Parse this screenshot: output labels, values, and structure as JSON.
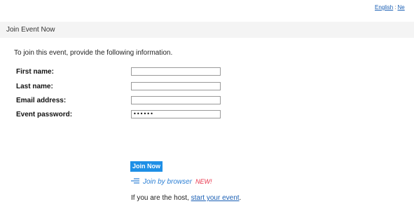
{
  "language_bar": {
    "current_language": "English",
    "separator": ":",
    "other_link": "Ne"
  },
  "header": {
    "title": "Join Event Now"
  },
  "form": {
    "instruction": "To join this event, provide the following information.",
    "fields": [
      {
        "label": "First name:",
        "value": ""
      },
      {
        "label": "Last name:",
        "value": ""
      },
      {
        "label": "Email address:",
        "value": ""
      },
      {
        "label": "Event password:",
        "value": "••••••"
      }
    ]
  },
  "actions": {
    "join_now": "Join Now",
    "join_by_browser": "Join by browser",
    "new_badge": "NEW!",
    "browser_icon": "lines-arrow-icon"
  },
  "host": {
    "text_prefix": "If you are the host, ",
    "link": "start your event",
    "text_suffix": "."
  },
  "colors": {
    "button_bg": "#1e8fe6",
    "link": "#1a5fb4",
    "browser_link": "#2b7fd4",
    "new_badge": "#e8334a",
    "header_band": "#f4f4f4"
  }
}
